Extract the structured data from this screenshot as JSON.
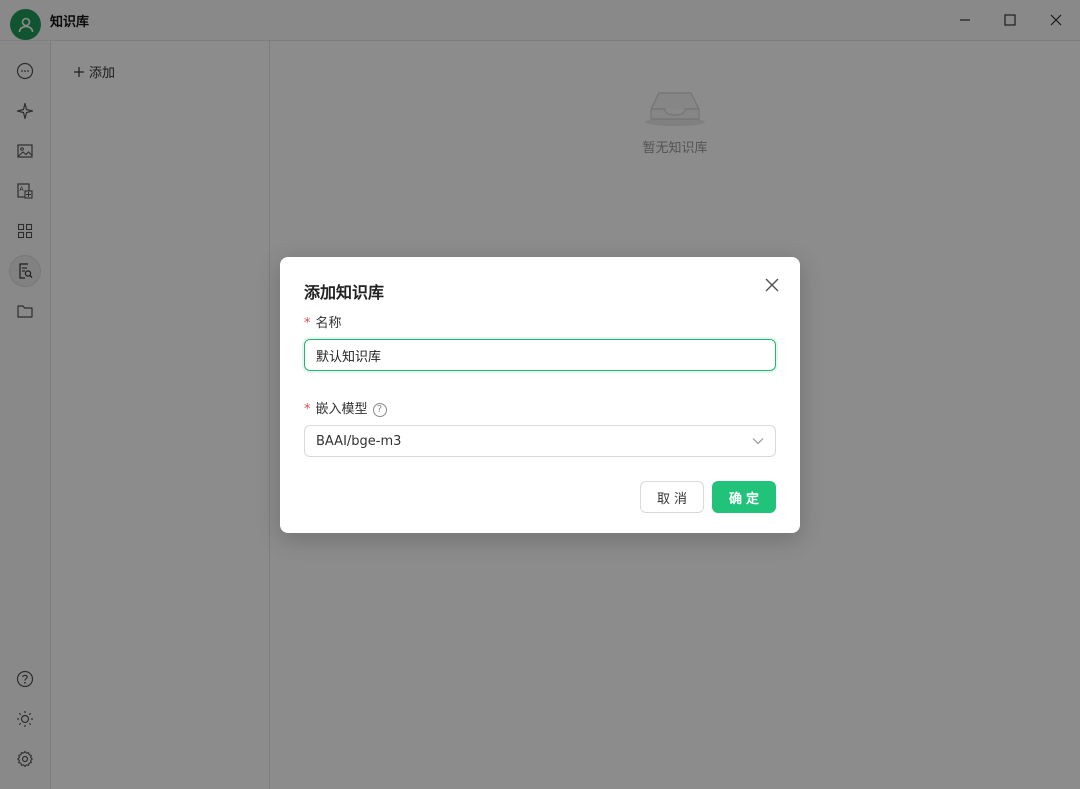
{
  "window": {
    "title": "知识库",
    "icons": [
      "avatar-icon",
      "minimize-icon",
      "maximize-icon",
      "close-icon"
    ]
  },
  "sidebar": {
    "top_items": [
      {
        "icon": "chat-icon"
      },
      {
        "icon": "sparkle-icon"
      },
      {
        "icon": "image-icon"
      },
      {
        "icon": "translate-icon"
      },
      {
        "icon": "apps-grid-icon"
      },
      {
        "icon": "knowledge-search-icon",
        "active": true
      },
      {
        "icon": "folder-icon"
      }
    ],
    "bottom_items": [
      {
        "icon": "help-icon"
      },
      {
        "icon": "sun-icon"
      },
      {
        "icon": "settings-gear-icon"
      }
    ]
  },
  "list_panel": {
    "add_label": "添加"
  },
  "main": {
    "empty_text": "暂无知识库"
  },
  "modal": {
    "title": "添加知识库",
    "name_label": "名称",
    "name_value": "默认知识库",
    "model_label": "嵌入模型",
    "model_value": "BAAI/bge-m3",
    "cancel_label": "取消",
    "ok_label": "确定"
  },
  "colors": {
    "accent": "#21c27a",
    "avatar": "#1f9a5a",
    "required": "#e5484d"
  }
}
